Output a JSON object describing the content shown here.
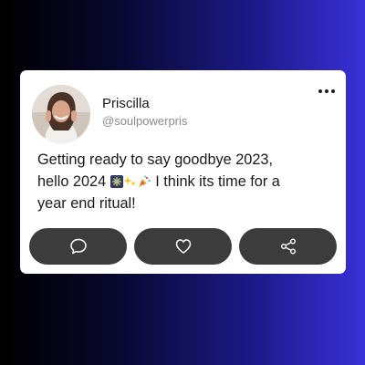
{
  "post": {
    "author_name": "Priscilla",
    "author_handle": "@soulpowerpris",
    "text_line1": "Getting ready to say goodbye 2023,",
    "text_line2_start": "hello 2024",
    "text_line2_end": "I think its time for a",
    "text_line3": "year end ritual!"
  },
  "icons": {
    "more": "more-horizontal-icon",
    "comment": "comment-icon",
    "like": "heart-icon",
    "share": "share-icon",
    "emojis": [
      "fireworks-icon",
      "sparkles-icon",
      "party-popper-icon"
    ]
  },
  "colors": {
    "card_bg": "#ffffff",
    "button_bg": "#3c3c3c",
    "text": "#1a1a1a",
    "handle": "#8a8a8a"
  }
}
